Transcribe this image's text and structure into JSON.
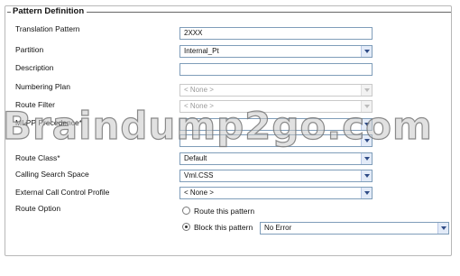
{
  "section": {
    "legend": "Pattern Definition"
  },
  "fields": {
    "translation_pattern": {
      "label": "Translation Pattern",
      "value": "2XXX"
    },
    "partition": {
      "label": "Partition",
      "value": "Internal_Pt"
    },
    "description": {
      "label": "Description",
      "value": ""
    },
    "numbering_plan": {
      "label": "Numbering Plan",
      "value": "< None >"
    },
    "route_filter": {
      "label": "Route Filter",
      "value": "< None >"
    },
    "mlpp_precedence": {
      "label": "MLPP Precedence",
      "required_mark": "*",
      "value": ""
    },
    "resource_priority": {
      "label": "",
      "value": ""
    },
    "route_class": {
      "label": "Route Class",
      "required_mark": "*",
      "value": "Default"
    },
    "calling_search_space": {
      "label": "Calling Search Space",
      "value": "Vml.CSS"
    },
    "external_call_control_profile": {
      "label": "External Call Control Profile",
      "value": "< None >"
    },
    "route_option": {
      "label": "Route Option",
      "option_route": "Route this pattern",
      "option_block": "Block this pattern",
      "block_reason": "No Error",
      "selected": "block"
    }
  },
  "watermark": {
    "text": "Braindump2go.com"
  },
  "colors": {
    "field_border": "#7f9db9",
    "disabled_text": "#9a9a9a",
    "dropdown_arrow": "#2f4b86"
  },
  "icons": {
    "dropdown": "chevron-down-icon",
    "radio": "radio-icon"
  }
}
